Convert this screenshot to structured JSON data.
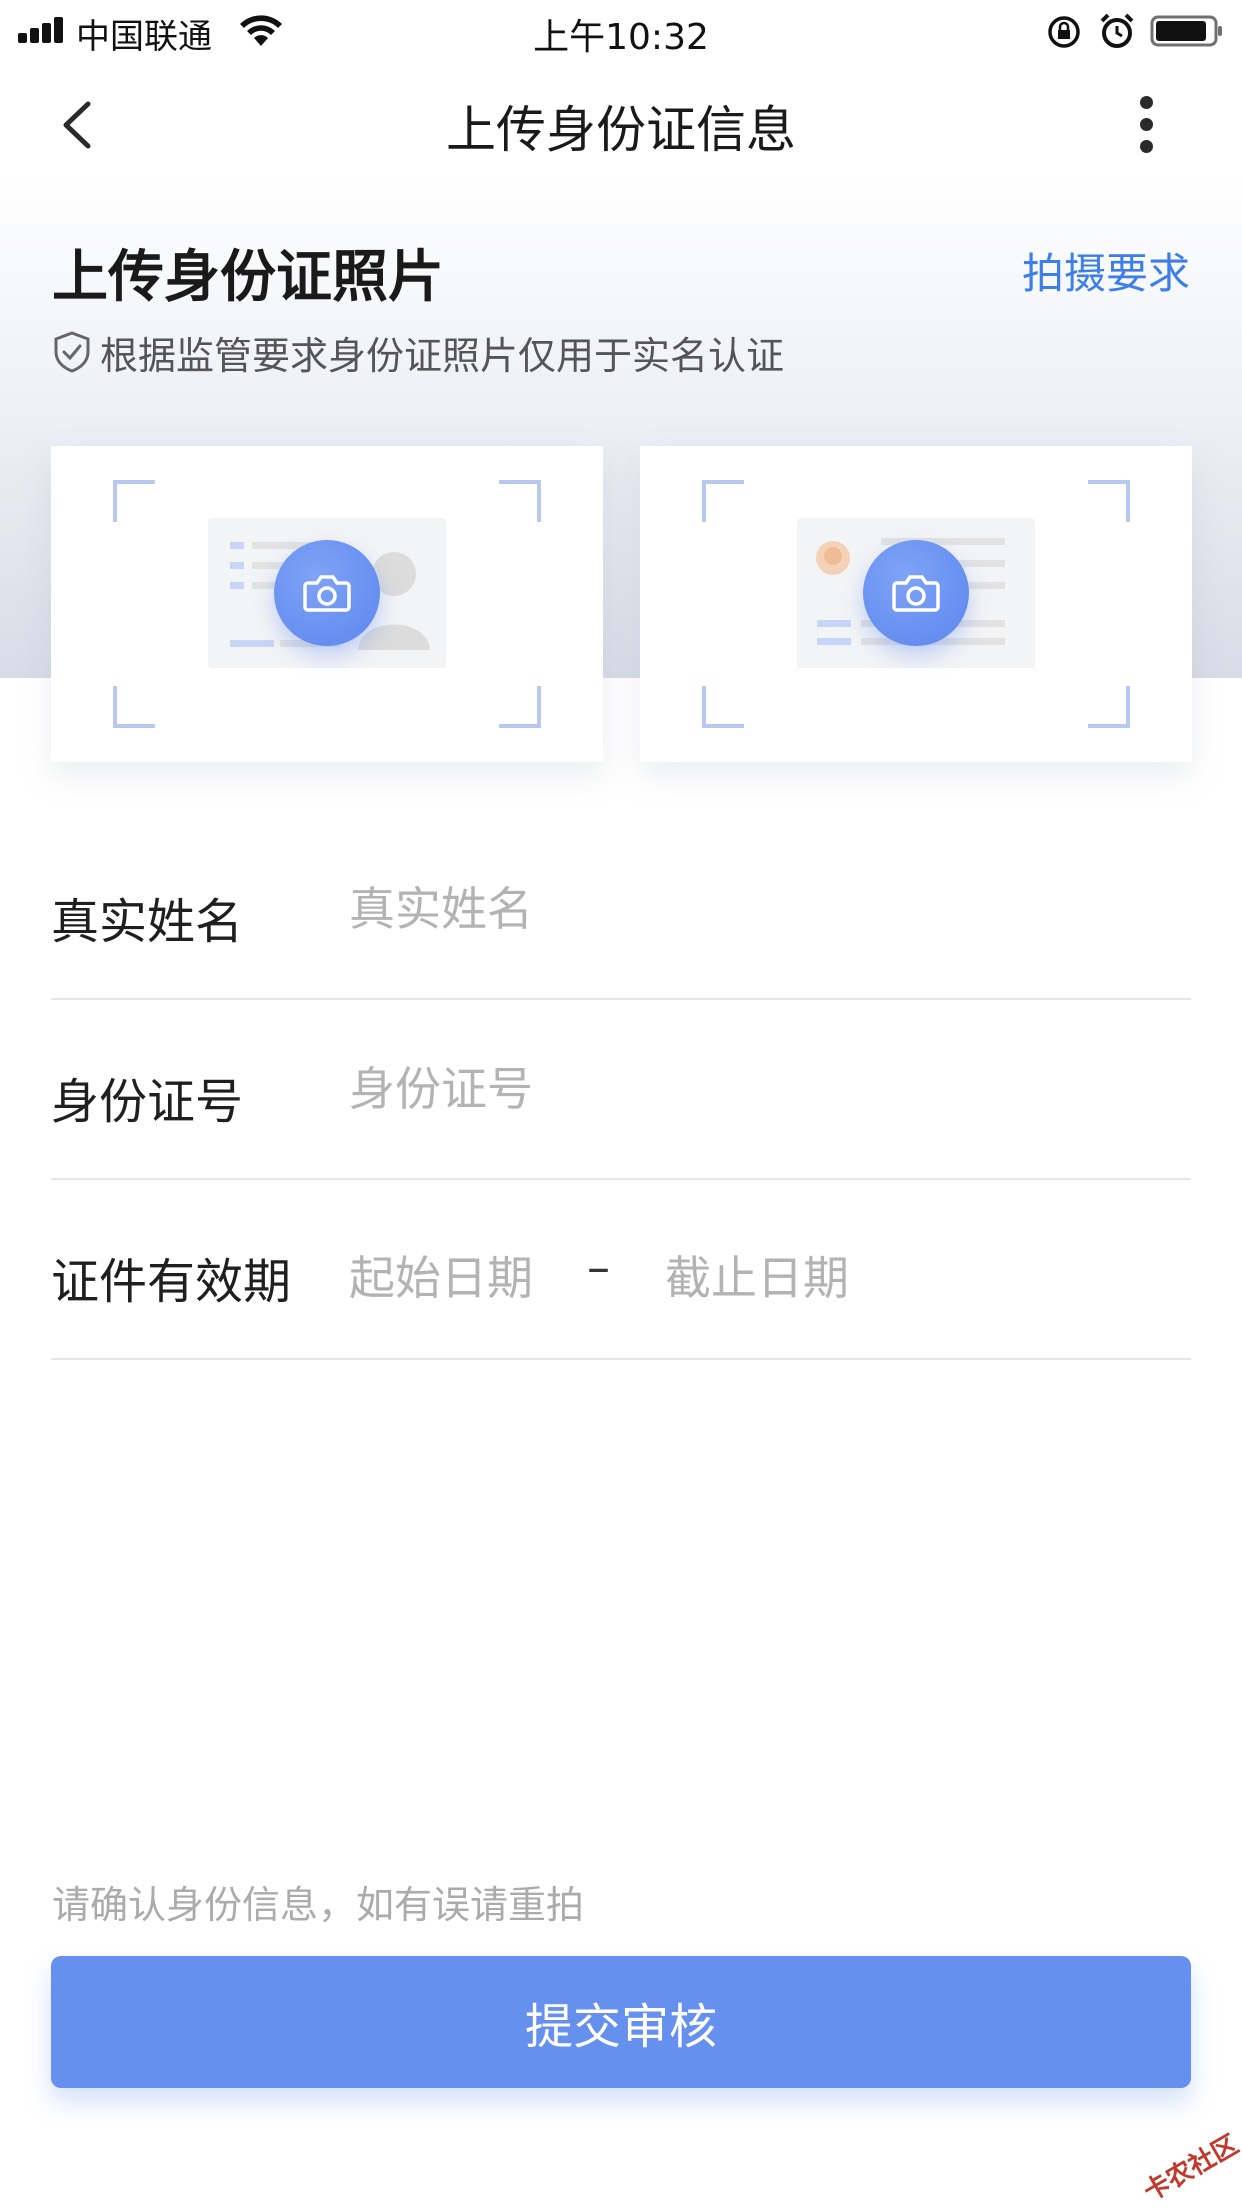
{
  "status_bar": {
    "carrier": "中国联通",
    "time": "上午10:32"
  },
  "nav": {
    "title": "上传身份证信息"
  },
  "upload": {
    "title": "上传身份证照片",
    "requirements_link": "拍摄要求",
    "notice": "根据监管要求身份证照片仅用于实名认证"
  },
  "form": {
    "name_label": "真实姓名",
    "name_placeholder": "真实姓名",
    "id_label": "身份证号",
    "id_placeholder": "身份证号",
    "validity_label": "证件有效期",
    "start_date_placeholder": "起始日期",
    "separator": "–",
    "end_date_placeholder": "截止日期"
  },
  "footer": {
    "hint": "请确认身份信息，如有误请重拍",
    "submit_label": "提交审核"
  },
  "watermark": "卡农社区",
  "colors": {
    "accent": "#3d7ee8",
    "button": "#6690ee",
    "placeholder": "#b3b3b3"
  },
  "icons": [
    "signal-icon",
    "wifi-icon",
    "rotation-lock-icon",
    "alarm-icon",
    "battery-icon",
    "back-arrow-icon",
    "more-icon",
    "shield-check-icon",
    "camera-icon"
  ]
}
